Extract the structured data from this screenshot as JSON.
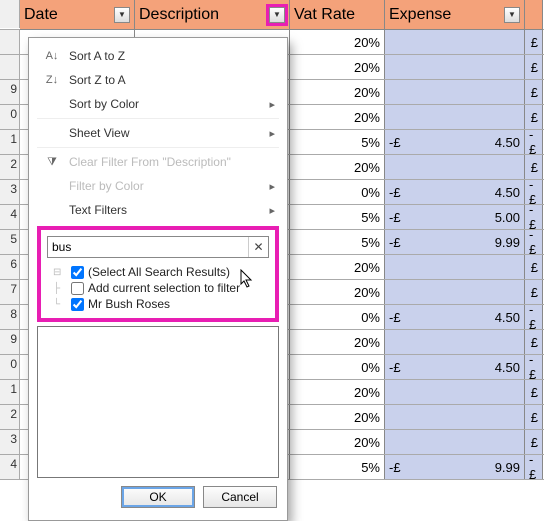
{
  "headers": {
    "date": "Date",
    "desc": "Description",
    "vat": "Vat Rate",
    "exp": "Expense"
  },
  "rows": [
    {
      "n": "",
      "vat": "20%",
      "exp_l": "",
      "exp_r": "",
      "x": "£"
    },
    {
      "n": "",
      "vat": "20%",
      "exp_l": "",
      "exp_r": "",
      "x": "£"
    },
    {
      "n": "9",
      "vat": "20%",
      "exp_l": "",
      "exp_r": "",
      "x": "£"
    },
    {
      "n": "0",
      "vat": "20%",
      "exp_l": "",
      "exp_r": "",
      "x": "£"
    },
    {
      "n": "1",
      "vat": "5%",
      "exp_l": "-£",
      "exp_r": "4.50",
      "x": "-£"
    },
    {
      "n": "2",
      "vat": "20%",
      "exp_l": "",
      "exp_r": "",
      "x": "£"
    },
    {
      "n": "3",
      "vat": "0%",
      "exp_l": "-£",
      "exp_r": "4.50",
      "x": "-£"
    },
    {
      "n": "4",
      "vat": "5%",
      "exp_l": "-£",
      "exp_r": "5.00",
      "x": "-£"
    },
    {
      "n": "5",
      "vat": "5%",
      "exp_l": "-£",
      "exp_r": "9.99",
      "x": "-£"
    },
    {
      "n": "6",
      "vat": "20%",
      "exp_l": "",
      "exp_r": "",
      "x": "£"
    },
    {
      "n": "7",
      "vat": "20%",
      "exp_l": "",
      "exp_r": "",
      "x": "£"
    },
    {
      "n": "8",
      "vat": "0%",
      "exp_l": "-£",
      "exp_r": "4.50",
      "x": "-£"
    },
    {
      "n": "9",
      "vat": "20%",
      "exp_l": "",
      "exp_r": "",
      "x": "£"
    },
    {
      "n": "0",
      "vat": "0%",
      "exp_l": "-£",
      "exp_r": "4.50",
      "x": "-£"
    },
    {
      "n": "1",
      "vat": "20%",
      "exp_l": "",
      "exp_r": "",
      "x": "£"
    },
    {
      "n": "2",
      "vat": "20%",
      "exp_l": "",
      "exp_r": "",
      "x": "£"
    },
    {
      "n": "3",
      "vat": "20%",
      "exp_l": "",
      "exp_r": "",
      "x": "£"
    },
    {
      "n": "4",
      "vat": "5%",
      "exp_l": "-£",
      "exp_r": "9.99",
      "x": "-£"
    }
  ],
  "panel": {
    "sort_az": "Sort A to Z",
    "sort_za": "Sort Z to A",
    "sort_color": "Sort by Color",
    "sheet_view": "Sheet View",
    "clear_filter": "Clear Filter From \"Description\"",
    "filter_color": "Filter by Color",
    "text_filters": "Text Filters",
    "search_value": "bus",
    "opt_all": "(Select All Search Results)",
    "opt_add": "Add current selection to filter",
    "opt_bush": "Mr Bush Roses",
    "ok": "OK",
    "cancel": "Cancel"
  },
  "icons": {
    "az_prefix": "A↓",
    "za_prefix": "Z↓"
  }
}
